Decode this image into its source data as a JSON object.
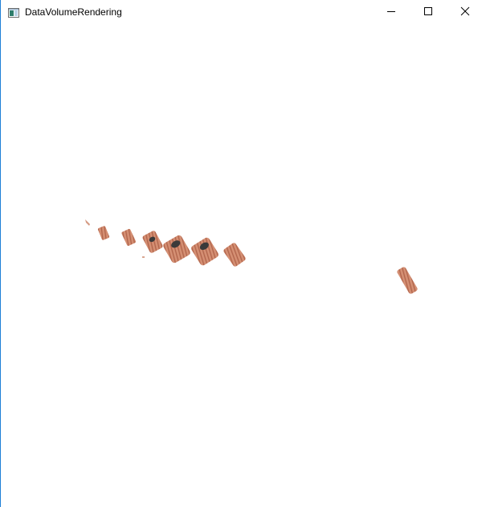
{
  "window": {
    "title": "DataVolumeRendering",
    "icon": "app-window-icon",
    "controls": {
      "minimize": "minimize-icon",
      "maximize": "maximize-icon",
      "close": "close-icon"
    }
  },
  "viewport": {
    "background": "#ffffff",
    "volume_color": "#c98062",
    "volume_dark": "#8e4a35",
    "hole_color": "#3a3a3a",
    "border_accent": "#1e7fd6"
  }
}
